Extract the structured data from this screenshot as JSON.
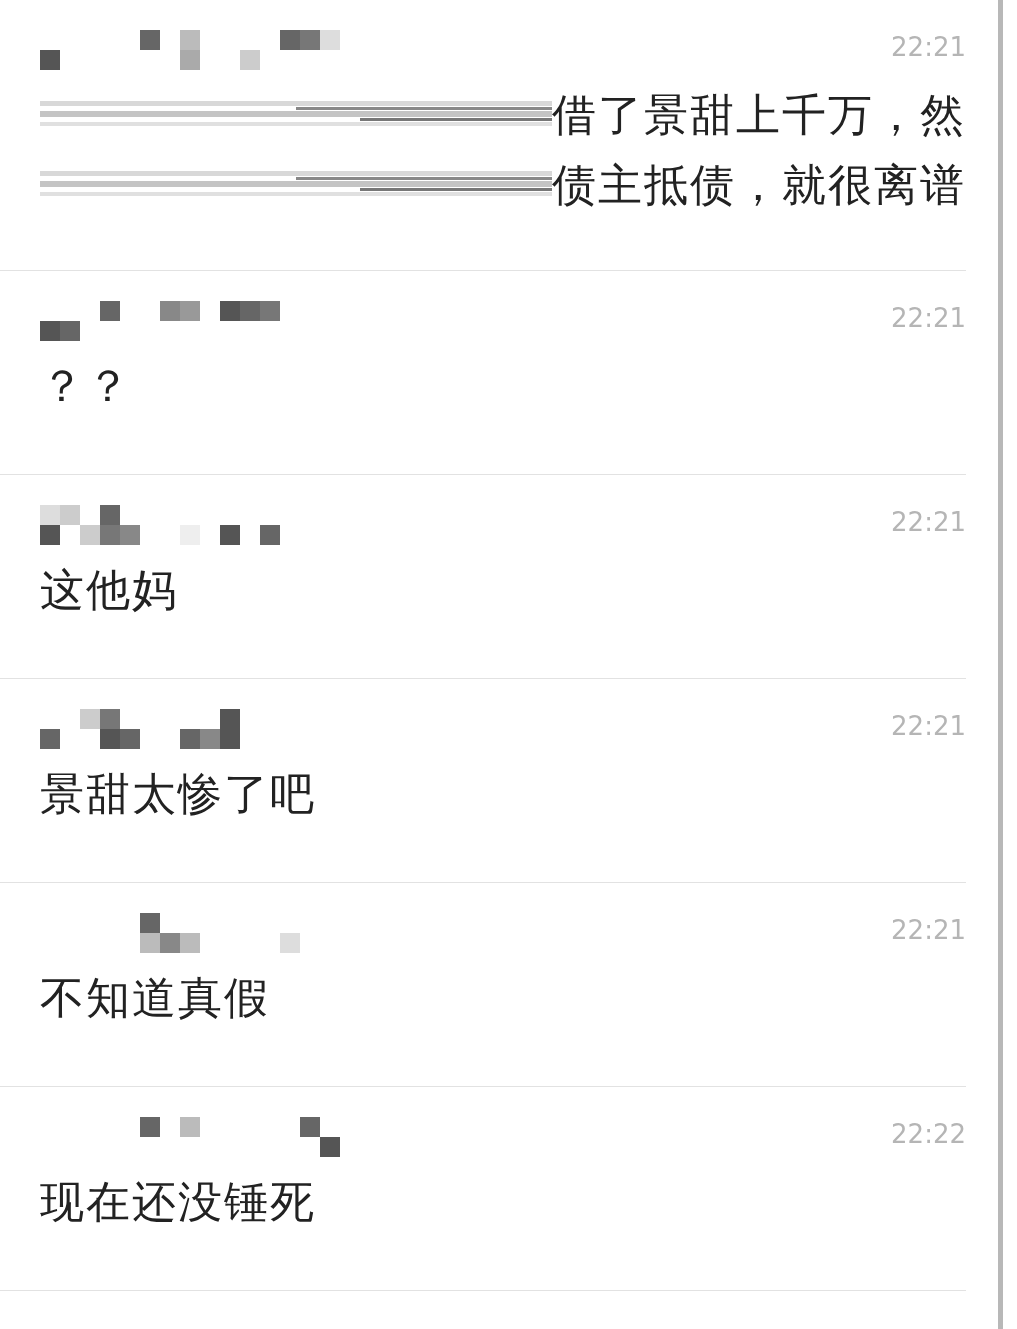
{
  "messages": [
    {
      "time": "22:21",
      "smudged": true,
      "lines": [
        "借了景甜上千万，然",
        "债主抵债，就很离谱"
      ]
    },
    {
      "time": "22:21",
      "smudged": false,
      "lines": [
        "？？"
      ]
    },
    {
      "time": "22:21",
      "smudged": false,
      "lines": [
        "这他妈"
      ]
    },
    {
      "time": "22:21",
      "smudged": false,
      "lines": [
        "景甜太惨了吧"
      ]
    },
    {
      "time": "22:21",
      "smudged": false,
      "lines": [
        "不知道真假"
      ]
    },
    {
      "time": "22:22",
      "smudged": false,
      "lines": [
        "现在还没锤死"
      ]
    }
  ]
}
